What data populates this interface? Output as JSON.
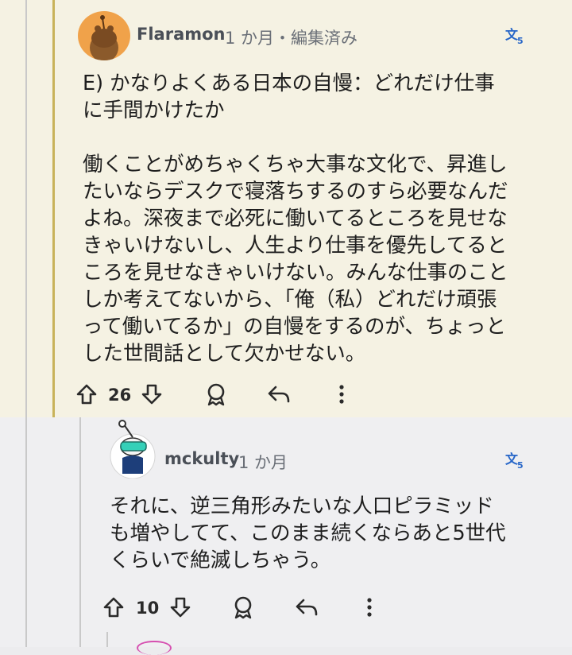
{
  "comments": [
    {
      "username": "Flaramon",
      "meta": "1 か月・編集済み",
      "body": "E) かなりよくある日本の自慢：どれだけ仕事\nに手間かけたか\n\n働くことがめちゃくちゃ大事な文化で、昇進し\nたいならデスクで寝落ちするのすら必要なんだ\nよね。深夜まで必死に働いてるところを見せな\nきゃいけないし、人生より仕事を優先してると\nころを見せなきゃいけない。みんな仕事のこと\nしか考えてないから、「俺（私）どれだけ頑張\nって働いてるか」の自慢をするのが、ちょっと\nした世間話として欠かせない。",
      "votes": "26"
    },
    {
      "username": "mckulty",
      "meta": "1 か月",
      "body": "それに、逆三角形みたいな人口ピラミッド\nも増やしてて、このまま続くならあと5世代\nくらいで絶滅しちゃう。",
      "votes": "10"
    }
  ],
  "icons": {
    "upvote": "arrow-up-icon",
    "downvote": "arrow-down-icon",
    "award": "award-icon",
    "reply": "reply-icon",
    "more": "more-vertical-icon",
    "translate": "translate-icon"
  },
  "colors": {
    "highlight_bg": "#f5f2e3",
    "avatar1_bg": "#f0a24a",
    "accent_blue": "#2766c8"
  }
}
